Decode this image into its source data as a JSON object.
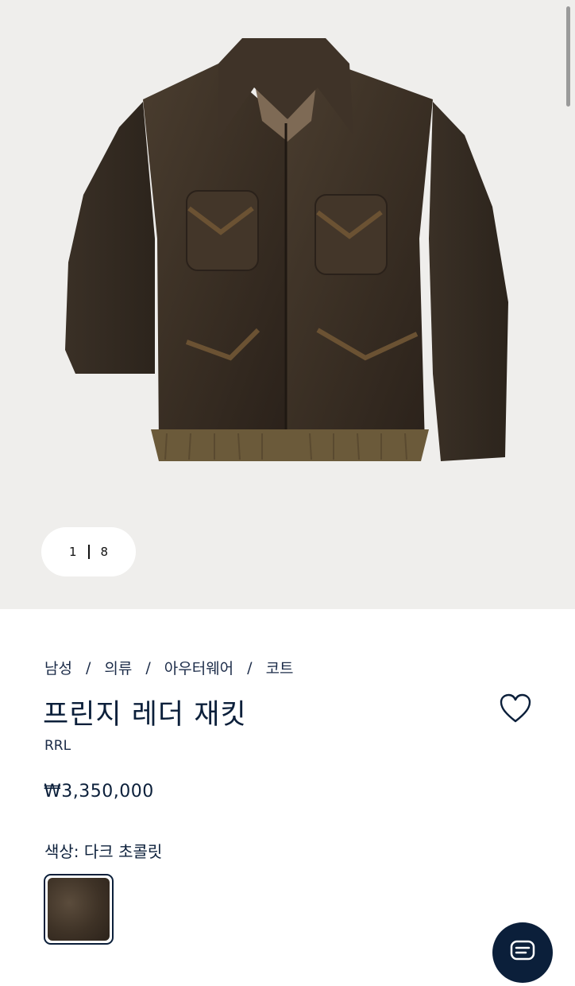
{
  "gallery": {
    "current_index": "1",
    "total": "8",
    "image_icon": "leather-fringe-jacket-photo"
  },
  "breadcrumb": [
    "남성",
    "의류",
    "아우터웨어",
    "코트"
  ],
  "breadcrumb_separator": "/",
  "product": {
    "title": "프린지 레더 재킷",
    "brand": "RRL",
    "price": "₩3,350,000",
    "color_label": "색상:",
    "color_name": "다크 초콜릿"
  },
  "icons": {
    "wishlist": "heart-outline-icon",
    "chat": "chat-icon"
  },
  "colors": {
    "navy": "#0b1f3a",
    "gallery_bg": "#efeeec",
    "jacket_brown": "#3e3226"
  }
}
